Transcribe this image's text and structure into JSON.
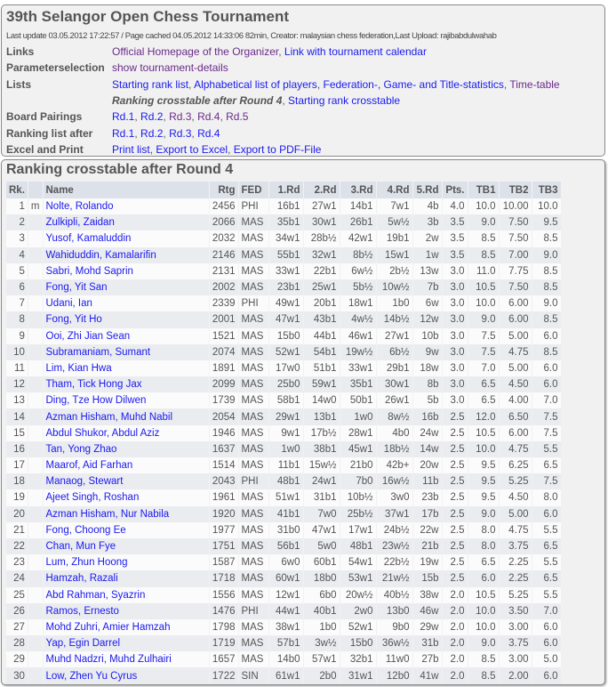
{
  "header": {
    "title": "39th Selangor Open Chess Tournament",
    "last_update": "Last update 03.05.2012 17:22:57 / Page cached 04.05.2012 14:33:06 82min, Creator: malaysian chess federation,Last Upload: rajibabdulwahab"
  },
  "info": [
    {
      "label": "Links",
      "links": [
        {
          "text": "Official Homepage of the Organizer",
          "visited": true
        },
        {
          "text": "Link with tournament calendar"
        }
      ]
    },
    {
      "label": "Parameterselection",
      "links": [
        {
          "text": "show tournament-details",
          "visited": true
        }
      ]
    },
    {
      "label": "Lists",
      "links": [
        {
          "text": "Starting rank list"
        },
        {
          "text": "Alphabetical list of players"
        },
        {
          "text": "Federation-, Game- and Title-statistics"
        },
        {
          "text": "Time-table",
          "visited": true
        }
      ]
    },
    {
      "label": "",
      "links": [
        {
          "text": "Ranking crosstable after Round 4",
          "current": true
        },
        {
          "text": "Starting rank crosstable"
        }
      ]
    },
    {
      "label": "Board Pairings",
      "links": [
        {
          "text": "Rd.1"
        },
        {
          "text": "Rd.2"
        },
        {
          "text": "Rd.3",
          "visited": true
        },
        {
          "text": "Rd.4",
          "visited": true
        },
        {
          "text": "Rd.5",
          "visited": true
        }
      ]
    },
    {
      "label": "Ranking list after",
      "links": [
        {
          "text": "Rd.1"
        },
        {
          "text": "Rd.2"
        },
        {
          "text": "Rd.3"
        },
        {
          "text": "Rd.4"
        }
      ]
    },
    {
      "label": "Excel and Print",
      "links": [
        {
          "text": "Print list"
        },
        {
          "text": "Export to Excel"
        },
        {
          "text": "Export to PDF-File"
        }
      ]
    }
  ],
  "crosstable": {
    "title": "Ranking crosstable after Round 4",
    "columns": [
      "Rk.",
      "",
      "Name",
      "Rtg",
      "FED",
      "1.Rd",
      "2.Rd",
      "3.Rd",
      "4.Rd",
      "5.Rd",
      "Pts.",
      "TB1",
      "TB2",
      "TB3"
    ],
    "rows": [
      [
        "1",
        "m",
        "Nolte, Rolando",
        "2456",
        "PHI",
        "16b1",
        "27w1",
        "14b1",
        "7w1",
        "4b",
        "4.0",
        "10.0",
        "10.00",
        "10.0"
      ],
      [
        "2",
        "",
        "Zulkipli, Zaidan",
        "2066",
        "MAS",
        "35b1",
        "30w1",
        "26b1",
        "5w½",
        "3b",
        "3.5",
        "9.0",
        "7.50",
        "9.5"
      ],
      [
        "3",
        "",
        "Yusof, Kamaluddin",
        "2032",
        "MAS",
        "34w1",
        "28b½",
        "42w1",
        "19b1",
        "2w",
        "3.5",
        "8.5",
        "7.50",
        "8.5"
      ],
      [
        "4",
        "",
        "Wahiduddin, Kamalarifin",
        "2146",
        "MAS",
        "55b1",
        "32w1",
        "8b½",
        "15w1",
        "1w",
        "3.5",
        "8.5",
        "7.00",
        "9.0"
      ],
      [
        "5",
        "",
        "Sabri, Mohd Saprin",
        "2131",
        "MAS",
        "33w1",
        "22b1",
        "6w½",
        "2b½",
        "13w",
        "3.0",
        "11.0",
        "7.75",
        "8.5"
      ],
      [
        "6",
        "",
        "Fong, Yit San",
        "2002",
        "MAS",
        "23b1",
        "25w1",
        "5b½",
        "10w½",
        "7b",
        "3.0",
        "10.5",
        "7.50",
        "8.5"
      ],
      [
        "7",
        "",
        "Udani, Ian",
        "2339",
        "PHI",
        "49w1",
        "20b1",
        "18w1",
        "1b0",
        "6w",
        "3.0",
        "10.0",
        "6.00",
        "9.0"
      ],
      [
        "8",
        "",
        "Fong, Yit Ho",
        "2001",
        "MAS",
        "47w1",
        "43b1",
        "4w½",
        "14b½",
        "12w",
        "3.0",
        "9.0",
        "6.00",
        "8.5"
      ],
      [
        "9",
        "",
        "Ooi, Zhi Jian Sean",
        "1521",
        "MAS",
        "15b0",
        "44b1",
        "46w1",
        "27w1",
        "10b",
        "3.0",
        "7.5",
        "5.00",
        "6.0"
      ],
      [
        "10",
        "",
        "Subramaniam, Sumant",
        "2074",
        "MAS",
        "52w1",
        "54b1",
        "19w½",
        "6b½",
        "9w",
        "3.0",
        "7.5",
        "4.75",
        "8.5"
      ],
      [
        "11",
        "",
        "Lim, Kian Hwa",
        "1891",
        "MAS",
        "17w0",
        "51b1",
        "33w1",
        "29b1",
        "18w",
        "3.0",
        "7.0",
        "5.00",
        "6.0"
      ],
      [
        "12",
        "",
        "Tham, Tick Hong Jax",
        "2099",
        "MAS",
        "25b0",
        "59w1",
        "35b1",
        "30w1",
        "8b",
        "3.0",
        "6.5",
        "4.50",
        "6.0"
      ],
      [
        "13",
        "",
        "Ding, Tze How Dilwen",
        "1739",
        "MAS",
        "58b1",
        "14w0",
        "50b1",
        "26w1",
        "5b",
        "3.0",
        "6.5",
        "4.00",
        "7.0"
      ],
      [
        "14",
        "",
        "Azman Hisham, Muhd Nabil",
        "2054",
        "MAS",
        "29w1",
        "13b1",
        "1w0",
        "8w½",
        "16b",
        "2.5",
        "12.0",
        "6.50",
        "7.5"
      ],
      [
        "15",
        "",
        "Abdul Shukor, Abdul Aziz",
        "1946",
        "MAS",
        "9w1",
        "17b½",
        "28w1",
        "4b0",
        "24w",
        "2.5",
        "10.5",
        "6.00",
        "7.5"
      ],
      [
        "16",
        "",
        "Tan, Yong Zhao",
        "1637",
        "MAS",
        "1w0",
        "38b1",
        "45w1",
        "18b½",
        "14w",
        "2.5",
        "10.0",
        "4.75",
        "5.5"
      ],
      [
        "17",
        "",
        "Maarof, Aid Farhan",
        "1514",
        "MAS",
        "11b1",
        "15w½",
        "21b0",
        "42b+",
        "20w",
        "2.5",
        "9.5",
        "6.25",
        "6.5"
      ],
      [
        "18",
        "",
        "Manaog, Stewart",
        "2043",
        "PHI",
        "48b1",
        "24w1",
        "7b0",
        "16w½",
        "11b",
        "2.5",
        "9.5",
        "5.25",
        "7.5"
      ],
      [
        "19",
        "",
        "Ajeet Singh, Roshan",
        "1961",
        "MAS",
        "51w1",
        "31b1",
        "10b½",
        "3w0",
        "23b",
        "2.5",
        "9.5",
        "4.50",
        "8.0"
      ],
      [
        "20",
        "",
        "Azman Hisham, Nur Nabila",
        "1920",
        "MAS",
        "41b1",
        "7w0",
        "25b½",
        "37w1",
        "17b",
        "2.5",
        "9.0",
        "5.00",
        "6.0"
      ],
      [
        "21",
        "",
        "Fong, Choong Ee",
        "1977",
        "MAS",
        "31b0",
        "47w1",
        "17w1",
        "24b½",
        "22w",
        "2.5",
        "8.0",
        "4.75",
        "5.5"
      ],
      [
        "22",
        "",
        "Chan, Mun Fye",
        "1751",
        "MAS",
        "56b1",
        "5w0",
        "48b1",
        "23w½",
        "21b",
        "2.5",
        "8.0",
        "3.75",
        "6.5"
      ],
      [
        "23",
        "",
        "Lum, Zhun Hoong",
        "1587",
        "MAS",
        "6w0",
        "60b1",
        "54w1",
        "22b½",
        "19w",
        "2.5",
        "6.5",
        "2.25",
        "5.5"
      ],
      [
        "24",
        "",
        "Hamzah, Razali",
        "1718",
        "MAS",
        "60w1",
        "18b0",
        "53w1",
        "21w½",
        "15b",
        "2.5",
        "6.0",
        "2.25",
        "6.5"
      ],
      [
        "25",
        "",
        "Abd Rahman, Syazrin",
        "1556",
        "MAS",
        "12w1",
        "6b0",
        "20w½",
        "40b½",
        "38w",
        "2.0",
        "10.5",
        "5.25",
        "5.5"
      ],
      [
        "26",
        "",
        "Ramos, Ernesto",
        "1476",
        "PHI",
        "44w1",
        "40b1",
        "2w0",
        "13b0",
        "46w",
        "2.0",
        "10.0",
        "3.50",
        "7.0"
      ],
      [
        "27",
        "",
        "Mohd Zuhri, Amier Hamzah",
        "1798",
        "MAS",
        "38w1",
        "1b0",
        "52w1",
        "9b0",
        "29w",
        "2.0",
        "10.0",
        "3.00",
        "6.0"
      ],
      [
        "28",
        "",
        "Yap, Egin Darrel",
        "1719",
        "MAS",
        "57b1",
        "3w½",
        "15b0",
        "36w½",
        "31b",
        "2.0",
        "9.0",
        "3.75",
        "6.0"
      ],
      [
        "29",
        "",
        "Muhd Nadzri, Muhd Zulhairi",
        "1657",
        "MAS",
        "14b0",
        "57w1",
        "32b1",
        "11w0",
        "27b",
        "2.0",
        "8.5",
        "3.00",
        "5.0"
      ],
      [
        "30",
        "",
        "Low, Zhen Yu Cyrus",
        "1722",
        "SIN",
        "61w1",
        "2b0",
        "31w1",
        "12b0",
        "41w",
        "2.0",
        "8.5",
        "2.00",
        "6.0"
      ]
    ]
  }
}
